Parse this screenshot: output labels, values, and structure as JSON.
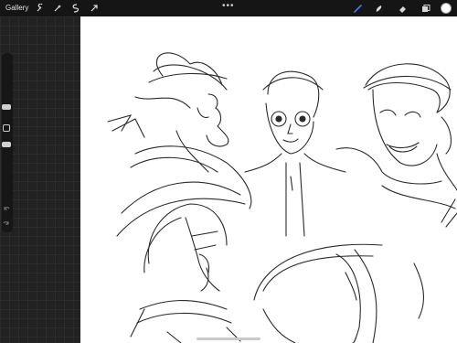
{
  "topbar": {
    "gallery_label": "Gallery",
    "left_tools": [
      "wrench-icon",
      "magic-wand-icon",
      "selection-icon",
      "transform-arrow-icon"
    ],
    "more_label": "•••",
    "right_tools": [
      "brush-icon",
      "smudge-icon",
      "eraser-icon",
      "layers-icon"
    ],
    "active_tool": "brush-icon",
    "accent_color": "#3d7bff",
    "current_color": "#ffffff"
  },
  "sidebar": {
    "controls": [
      "brush-size-slider",
      "modify-button",
      "opacity-slider",
      "undo-icon",
      "redo-icon"
    ]
  },
  "canvas": {
    "background": "#ffffff",
    "content": "pencil-sketches"
  }
}
